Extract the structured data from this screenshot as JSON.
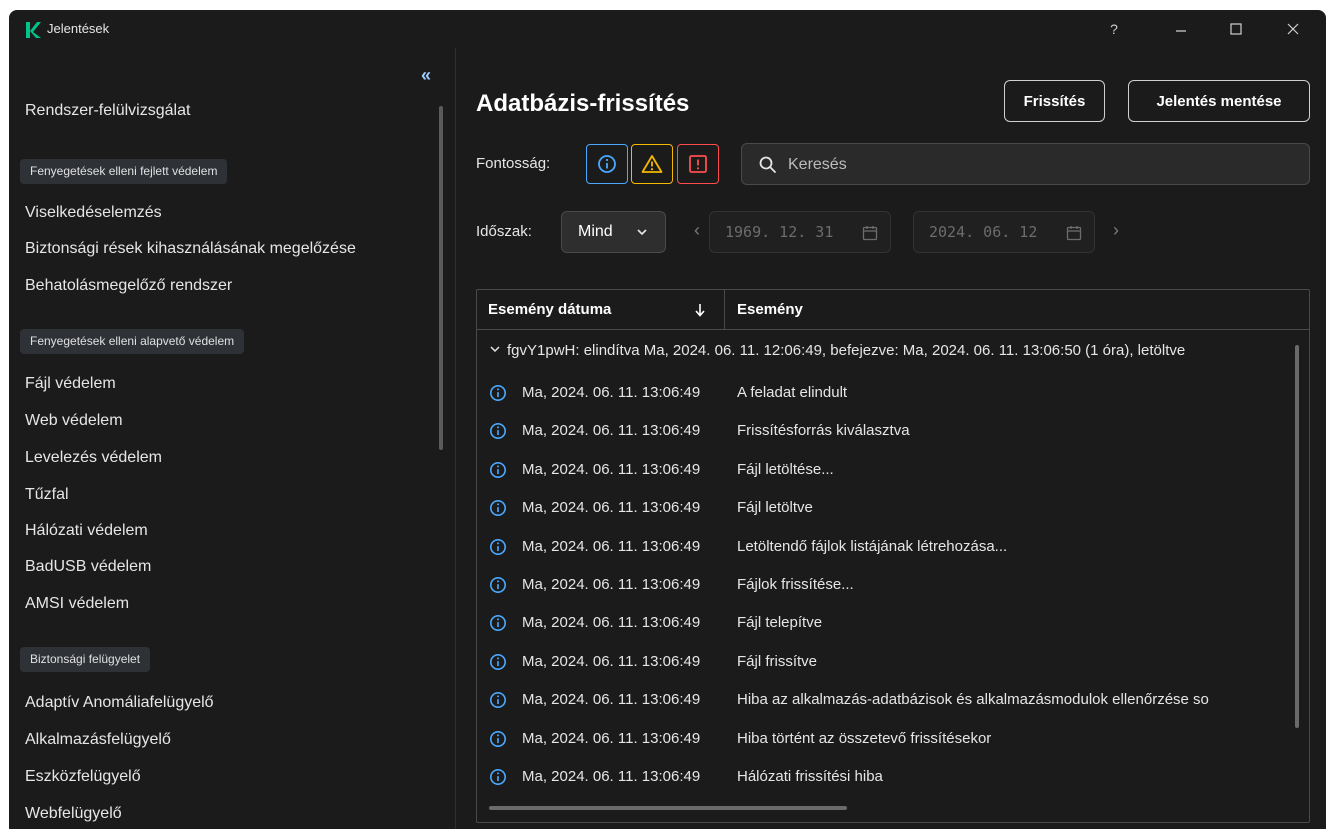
{
  "app": {
    "title": "Jelentések"
  },
  "window_controls": {
    "help": "?"
  },
  "sidebar": {
    "top_item": "Rendszer-felülvizsgálat",
    "groups": [
      {
        "header": "Fenyegetések elleni fejlett védelem",
        "items": [
          "Viselkedéselemzés",
          "Biztonsági rések kihasználásának megelőzése",
          "Behatolásmegelőző rendszer"
        ]
      },
      {
        "header": "Fenyegetések elleni alapvető védelem",
        "items": [
          "Fájl védelem",
          "Web védelem",
          "Levelezés védelem",
          "Tűzfal",
          "Hálózati védelem",
          "BadUSB védelem",
          "AMSI védelem"
        ]
      },
      {
        "header": "Biztonsági felügyelet",
        "items": [
          "Adaptív Anomáliafelügyelő",
          "Alkalmazásfelügyelő",
          "Eszközfelügyelő",
          "Webfelügyelő"
        ]
      }
    ]
  },
  "main": {
    "title": "Adatbázis-frissítés",
    "refresh_button": "Frissítés",
    "save_report_button": "Jelentés mentése",
    "severity_label": "Fontosság:",
    "search_placeholder": "Keresés",
    "period_label": "Időszak:",
    "period_value": "Mind",
    "date_from": "1969. 12. 31",
    "date_to": "2024. 06. 12"
  },
  "table": {
    "columns": [
      "Esemény dátuma",
      "Esemény"
    ],
    "group_title": "fgvY1pwH: elindítva Ma, 2024. 06. 11. 12:06:49, befejezve: Ma, 2024. 06. 11. 13:06:50 (1 óra), letöltve",
    "rows": [
      {
        "date": "Ma, 2024. 06. 11. 13:06:49",
        "event": "A feladat elindult"
      },
      {
        "date": "Ma, 2024. 06. 11. 13:06:49",
        "event": "Frissítésforrás kiválasztva"
      },
      {
        "date": "Ma, 2024. 06. 11. 13:06:49",
        "event": "Fájl letöltése..."
      },
      {
        "date": "Ma, 2024. 06. 11. 13:06:49",
        "event": "Fájl letöltve"
      },
      {
        "date": "Ma, 2024. 06. 11. 13:06:49",
        "event": "Letöltendő fájlok listájának létrehozása..."
      },
      {
        "date": "Ma, 2024. 06. 11. 13:06:49",
        "event": "Fájlok frissítése..."
      },
      {
        "date": "Ma, 2024. 06. 11. 13:06:49",
        "event": "Fájl telepítve"
      },
      {
        "date": "Ma, 2024. 06. 11. 13:06:49",
        "event": "Fájl frissítve"
      },
      {
        "date": "Ma, 2024. 06. 11. 13:06:49",
        "event": "Hiba az alkalmazás-adatbázisok és alkalmazásmodulok ellenőrzése so"
      },
      {
        "date": "Ma, 2024. 06. 11. 13:06:49",
        "event": "Hiba történt az összetevő frissítésekor"
      },
      {
        "date": "Ma, 2024. 06. 11. 13:06:49",
        "event": "Hálózati frissítési hiba"
      }
    ]
  },
  "colors": {
    "info": "#4aa8ff",
    "warning": "#f5b800",
    "error": "#ff4d4d",
    "logo": "#00c389"
  }
}
